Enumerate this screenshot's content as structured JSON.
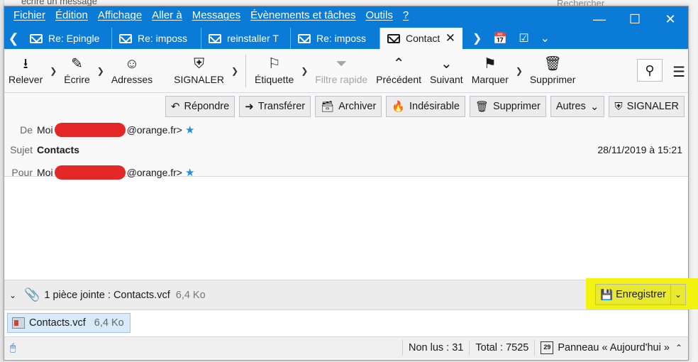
{
  "background": {
    "search_text": "Rechercher",
    "top_text": "écrire un message"
  },
  "menubar": {
    "items": [
      "Fichier",
      "Édition",
      "Affichage",
      "Aller à",
      "Messages",
      "Évènements et tâches",
      "Outils",
      "?"
    ]
  },
  "tabs": [
    {
      "label": "Re: Epingle"
    },
    {
      "label": "Re: imposs"
    },
    {
      "label": "reinstaller T"
    },
    {
      "label": "Re: imposs"
    },
    {
      "label": "Contact"
    }
  ],
  "toolbar": {
    "get": "Relever",
    "write": "Écrire",
    "address": "Adresses",
    "report": "SIGNALER",
    "tag": "Étiquette",
    "quick_filter": "Filtre rapide",
    "previous": "Précédent",
    "next": "Suivant",
    "mark": "Marquer",
    "delete": "Supprimer"
  },
  "actions": {
    "reply": "Répondre",
    "forward": "Transférer",
    "archive": "Archiver",
    "junk": "Indésirable",
    "delete": "Supprimer",
    "other": "Autres",
    "report": "SIGNALER"
  },
  "header": {
    "from_label": "De",
    "from_name": "Moi",
    "from_domain": "@orange.fr>",
    "subject_label": "Sujet",
    "subject": "Contacts",
    "date": "28/11/2019 à 15:21",
    "to_label": "Pour",
    "to_name": "Moi",
    "to_domain": "@orange.fr>"
  },
  "attachments": {
    "summary": "1 pièce jointe : Contacts.vcf",
    "summary_size": "6,4 Ko",
    "save_label": "Enregistrer",
    "file_name": "Contacts.vcf",
    "file_size": "6,4 Ko"
  },
  "status": {
    "unread": "Non lus : 31",
    "total": "Total : 7525",
    "today_day": "29",
    "today_pane": "Panneau « Aujourd'hui »"
  },
  "colors": {
    "accent": "#0a7bd6",
    "highlight": "#f3f311",
    "redaction": "#e32626",
    "star": "#1b8ef0"
  }
}
